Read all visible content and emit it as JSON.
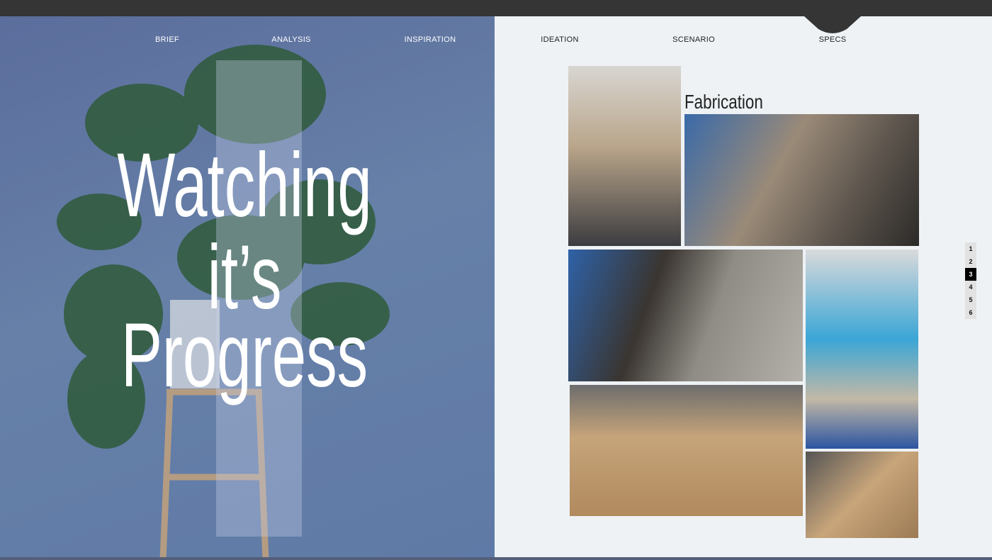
{
  "nav": {
    "items": [
      {
        "label": "BRIEF"
      },
      {
        "label": "ANALYSIS"
      },
      {
        "label": "INSPIRATION"
      },
      {
        "label": "IDEATION"
      },
      {
        "label": "SCENARIO"
      },
      {
        "label": "SPECS",
        "active": true
      }
    ]
  },
  "hero": {
    "line1": "Watching",
    "line2": "it’s",
    "line3": "Progress"
  },
  "section": {
    "title": "Fabrication"
  },
  "pager": {
    "pages": [
      "1",
      "2",
      "3",
      "4",
      "5",
      "6"
    ],
    "active": "3"
  },
  "colors": {
    "left_bg": "#5f7aa6",
    "right_bg": "#eef2f5",
    "topbar": "#353535"
  }
}
